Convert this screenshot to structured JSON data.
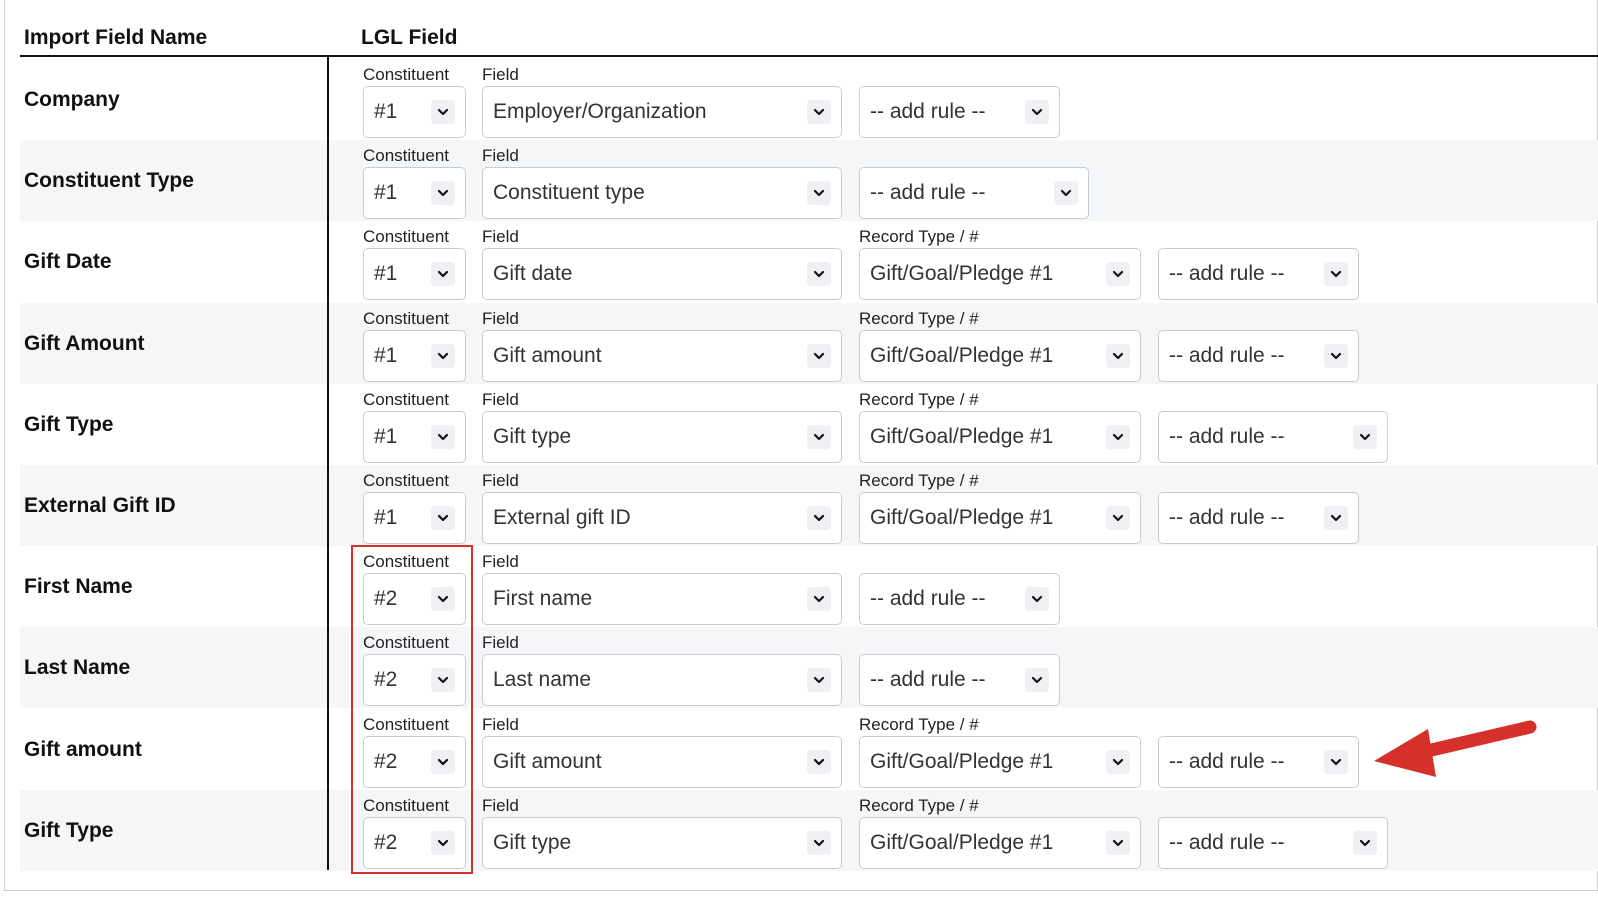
{
  "header": {
    "import_field_name": "Import Field Name",
    "lgl_field": "LGL Field"
  },
  "labels": {
    "constituent": "Constituent",
    "field": "Field",
    "record_type": "Record Type / #"
  },
  "rows": [
    {
      "name": "Company",
      "constituent": "#1",
      "field": "Employer/Organization",
      "record_type": null,
      "rule": "-- add rule --"
    },
    {
      "name": "Constituent Type",
      "constituent": "#1",
      "field": "Constituent type",
      "record_type": null,
      "rule": "-- add rule --"
    },
    {
      "name": "Gift Date",
      "constituent": "#1",
      "field": "Gift date",
      "record_type": "Gift/Goal/Pledge #1",
      "rule": "-- add rule --"
    },
    {
      "name": "Gift Amount",
      "constituent": "#1",
      "field": "Gift amount",
      "record_type": "Gift/Goal/Pledge #1",
      "rule": "-- add rule --"
    },
    {
      "name": "Gift Type",
      "constituent": "#1",
      "field": "Gift type",
      "record_type": "Gift/Goal/Pledge #1",
      "rule": "-- add rule --"
    },
    {
      "name": "External Gift ID",
      "constituent": "#1",
      "field": "External gift ID",
      "record_type": "Gift/Goal/Pledge #1",
      "rule": "-- add rule --"
    },
    {
      "name": "First Name",
      "constituent": "#2",
      "field": "First name",
      "record_type": null,
      "rule": "-- add rule --"
    },
    {
      "name": "Last Name",
      "constituent": "#2",
      "field": "Last name",
      "record_type": null,
      "rule": "-- add rule --"
    },
    {
      "name": "Gift amount",
      "constituent": "#2",
      "field": "Gift amount",
      "record_type": "Gift/Goal/Pledge #1",
      "rule": "-- add rule --"
    },
    {
      "name": "Gift Type",
      "constituent": "#2",
      "field": "Gift type",
      "record_type": "Gift/Goal/Pledge #1",
      "rule": "-- add rule --"
    }
  ],
  "colors": {
    "highlight": "#d6302a",
    "row_alt_bg": "#f5f6f8"
  },
  "annotations": {
    "highlight_box": "constituent #2 selects",
    "arrow_target": "Gift amount row add-rule select",
    "arrow_icon": "red-arrow-icon"
  }
}
